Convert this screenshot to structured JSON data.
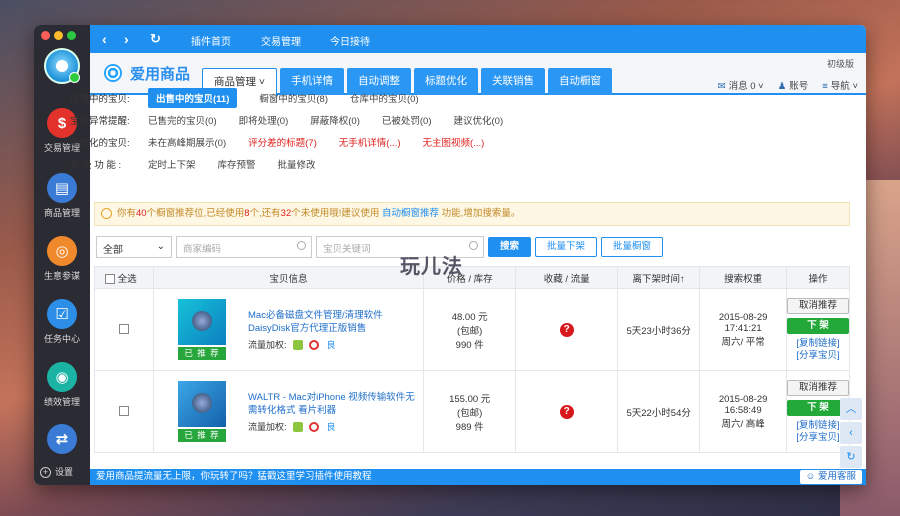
{
  "sidebar": {
    "items": [
      {
        "label": "交易管理",
        "icon": "$"
      },
      {
        "label": "商品管理",
        "icon": "▤"
      },
      {
        "label": "生意参谋",
        "icon": "◎"
      },
      {
        "label": "任务中心",
        "icon": "☑"
      },
      {
        "label": "绩效管理",
        "icon": "◉"
      },
      {
        "label": "",
        "icon": "⇄"
      }
    ],
    "settings": "设置"
  },
  "topbar": {
    "links": [
      "插件首页",
      "交易管理",
      "今日接待"
    ]
  },
  "header": {
    "logo": "爱用商品",
    "version": "初级版",
    "tabs": [
      "商品管理",
      "手机详情",
      "自动调整",
      "标题优化",
      "关联销售",
      "自动橱窗"
    ],
    "messages": "消息 0",
    "account": "账号",
    "nav": "导航"
  },
  "filters": {
    "row1": {
      "label": "店铺中的宝贝:",
      "options": [
        "出售中的宝贝(11)",
        "橱窗中的宝贝(8)",
        "仓库中的宝贝(0)"
      ]
    },
    "row2": {
      "label": "宝贝异常提醒:",
      "options": [
        "已售完的宝贝(0)",
        "即将处理(0)",
        "屏蔽降权(0)",
        "已被处罚(0)",
        "建议优化(0)"
      ]
    },
    "row3": {
      "label": "需优化的宝贝:",
      "options": [
        "未在高峰期展示(0)",
        "评分差的标题(7)",
        "无手机详情(...)",
        "无主图视频(...)"
      ]
    },
    "row4": {
      "label": "高 级 功 能 :",
      "options": [
        "定时上下架",
        "库存预警",
        "批量修改"
      ]
    }
  },
  "notice": {
    "p1": "你有",
    "n1": "40",
    "p2": "个橱窗推荐位,已经使用",
    "n2": "8",
    "p3": "个,还有",
    "n3": "32",
    "p4": "个未使用哦!建议使用 ",
    "link": "自动橱窗推荐",
    "p5": " 功能,增加搜索量。"
  },
  "search": {
    "select": "全部",
    "code_placeholder": "商家编码",
    "kw_placeholder": "宝贝关键词",
    "search": "搜索",
    "batch_down": "批量下架",
    "batch_window": "批量橱窗"
  },
  "watermark": "玩儿法",
  "table": {
    "headers": [
      "全选",
      "宝贝信息",
      "价格 / 库存",
      "收藏 / 流量",
      "离下架时间↑",
      "搜索权重",
      "操作"
    ],
    "rows": [
      {
        "title": "Mac必备磁盘文件管理/清理软件 DaisyDisk官方代理正版销售",
        "tag": "已 推 荐",
        "flow": "流量加权:",
        "liang": "良",
        "price": "48.00 元",
        "post": "(包邮)",
        "stock": "990 件",
        "q": "?",
        "time": "5天23小时36分",
        "date": "2015-08-29",
        "clock": "17:41:21",
        "week": "周六/ 平常",
        "b1": "取消推荐",
        "b2": "下 架",
        "l1": "[复制链接]",
        "l2": "[分享宝贝]"
      },
      {
        "title": "WALTR - Mac对iPhone 视频传输软件无需转化格式 看片利器",
        "tag": "已 推 荐",
        "flow": "流量加权:",
        "liang": "良",
        "price": "155.00 元",
        "post": "(包邮)",
        "stock": "989 件",
        "q": "?",
        "time": "5天22小时54分",
        "date": "2015-08-29",
        "clock": "16:58:49",
        "week": "周六/ 高峰",
        "b1": "取消推荐",
        "b2": "下 架",
        "l1": "[复制链接]",
        "l2": "[分享宝贝]"
      }
    ]
  },
  "bottombar": {
    "text": "爱用商品提流量无上限，你玩转了吗？猛戳这里学习插件使用教程",
    "service": "爱用客服"
  }
}
